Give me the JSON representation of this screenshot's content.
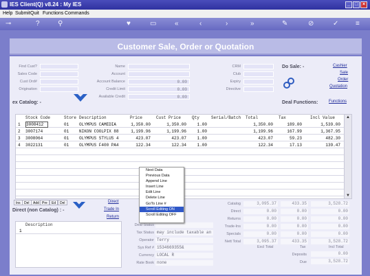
{
  "window": {
    "title": "IES Client(Q) v8.24 : My IES"
  },
  "menu": {
    "items": [
      "Help",
      "Submit",
      "Quit",
      "Functions",
      "Commands"
    ]
  },
  "banner": {
    "title": "Customer Sale, Order or Quotation"
  },
  "header": {
    "left_labels": [
      "Find Cust?",
      "Sales Code",
      "Cust Ord#",
      "Origination"
    ],
    "mid_labels": [
      "Name",
      "Account",
      "Account Balance",
      "Credit Limit",
      "Available Credit"
    ],
    "mid_values": [
      "",
      "",
      "0.00",
      "0.00",
      "0.00"
    ],
    "right_labels": [
      "CRM",
      "Club",
      "Expiry",
      "Directive"
    ],
    "do_sale": "Do Sale: -",
    "links": [
      "Cashier",
      "Sale",
      "Order",
      "Quotation"
    ],
    "ex_catalog": "ex Catalog: -",
    "deal_functions": "Deal Functions:",
    "functions_link": "Functions"
  },
  "grid": {
    "columns": [
      "Stock Code",
      "Store",
      "Description",
      "Price",
      "Cust Price",
      "Qty",
      "Serial/Batch",
      "Total",
      "Tax",
      "Incl Value"
    ],
    "rows": [
      {
        "n": "1",
        "code": "3008412",
        "store": "01",
        "desc": "OLYMPUS CAMEDIA",
        "price": "1,350.00",
        "cprice": "1,350.00",
        "qty": "1.00",
        "serial": "",
        "total": "1,350.00",
        "tax": "189.00",
        "incl": "1,539.00"
      },
      {
        "n": "2",
        "code": "3007174",
        "store": "01",
        "desc": "NIKON COOLPIX 88",
        "price": "1,199.96",
        "cprice": "1,199.96",
        "qty": "1.00",
        "serial": "",
        "total": "1,199.96",
        "tax": "167.99",
        "incl": "1,367.95"
      },
      {
        "n": "3",
        "code": "3008064",
        "store": "01",
        "desc": "OLYMPUS STYLUS 4",
        "price": "423.07",
        "cprice": "423.07",
        "qty": "1.00",
        "serial": "",
        "total": "423.07",
        "tax": "59.23",
        "incl": "482.30"
      },
      {
        "n": "4",
        "code": "3022131",
        "store": "01",
        "desc": "OLYMPUS F400 PA4",
        "price": "122.34",
        "cprice": "122.34",
        "qty": "1.00",
        "serial": "",
        "total": "122.34",
        "tax": "17.13",
        "incl": "139.47"
      }
    ]
  },
  "context_menu": {
    "items": [
      "Next Data",
      "Previous Data",
      "Append Line",
      "Insert Line",
      "Edit Line",
      "Delete Line",
      "GoTo Line #",
      "Scroll Editing ON",
      "Scroll Editing OFF"
    ],
    "selected_index": 7
  },
  "tabs": [
    "Ins",
    "Del",
    "Add",
    "Pre",
    "Ed",
    "Del"
  ],
  "direct": {
    "links": [
      "Direct",
      "Trade In",
      "Return"
    ],
    "title": "Direct (non Catalog) : -",
    "column": "Description",
    "row_number": "1"
  },
  "deal": {
    "labels": [
      "Deal Status",
      "Tax Status",
      "Operator",
      "Sys Ref #",
      "Currency",
      "Rate Book"
    ],
    "values": [
      "",
      "may include taxable an",
      "Terry",
      "1534669355&",
      "LOCAL R",
      "none"
    ]
  },
  "totals": {
    "labels": [
      "Catalog",
      "Direct",
      "Returns",
      "Trade-Ins",
      "Specials",
      "Nett Total"
    ],
    "excl": [
      "3,095.37",
      "0.00",
      "0.00",
      "0.00",
      "0.00",
      "3,095.37"
    ],
    "tax": [
      "433.35",
      "0.00",
      "0.00",
      "0.00",
      "0.00",
      "433.35"
    ],
    "incl": [
      "3,528.72",
      "0.00",
      "0.00",
      "0.00",
      "0.00",
      "3,528.72"
    ],
    "footer": [
      "Excl Total",
      "Tax",
      "Incl Total"
    ],
    "deposits_label": "Deposits",
    "deposits": "0.00",
    "due_label": "Due",
    "due": "3,528.72"
  }
}
